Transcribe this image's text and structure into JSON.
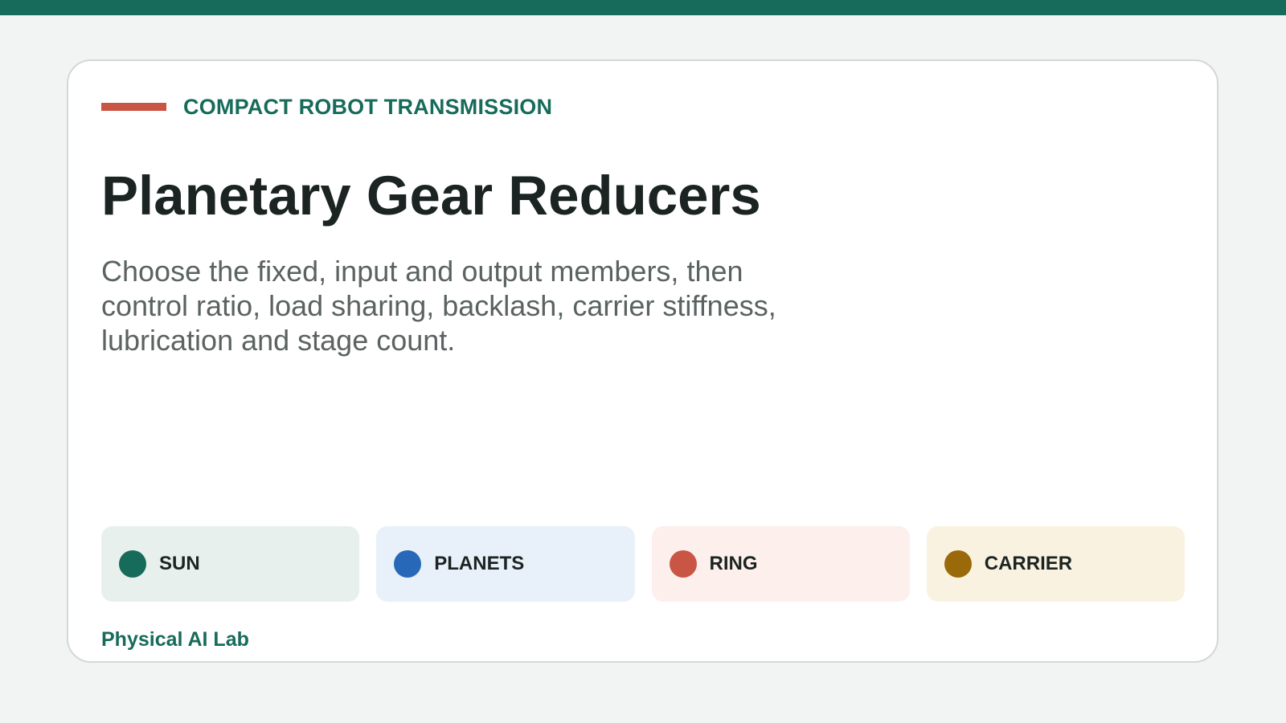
{
  "header": {
    "eyebrow": "COMPACT ROBOT TRANSMISSION",
    "accent_color": "#c95644",
    "brand_color": "#176b5a"
  },
  "main": {
    "title": "Planetary Gear Reducers",
    "subtitle": "Choose the fixed, input and output members, then control ratio, load sharing, backlash, carrier stiffness, lubrication and stage count."
  },
  "legend": {
    "items": [
      {
        "label": "SUN",
        "dot_color": "#176b5a",
        "bg_color": "#e7f0ed"
      },
      {
        "label": "PLANETS",
        "dot_color": "#2768b8",
        "bg_color": "#e8f0f9"
      },
      {
        "label": "RING",
        "dot_color": "#c95644",
        "bg_color": "#fdefec"
      },
      {
        "label": "CARRIER",
        "dot_color": "#9a6a0a",
        "bg_color": "#faf2e1"
      }
    ]
  },
  "footer": {
    "brand": "Physical AI Lab"
  }
}
